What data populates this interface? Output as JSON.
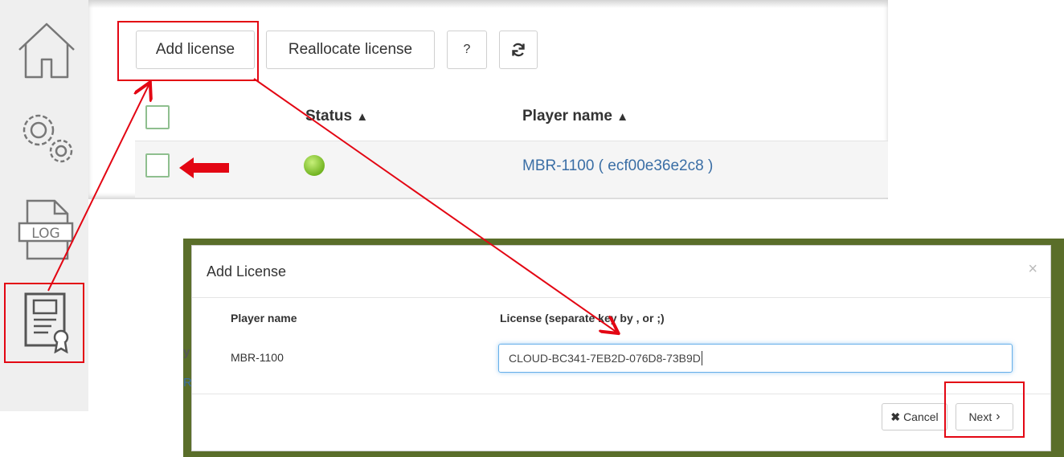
{
  "toolbar": {
    "add_license": "Add license",
    "reallocate_license": "Reallocate license",
    "help": "?",
    "refresh_icon": "refresh-icon"
  },
  "table": {
    "columns": [
      "Status",
      "Player name"
    ],
    "rows": [
      {
        "status": "online",
        "player_name": "MBR-1100 ( ecf00e36e2c8 )"
      }
    ]
  },
  "sidebar": {
    "items": [
      {
        "icon": "home-icon"
      },
      {
        "icon": "settings-gears-icon"
      },
      {
        "icon": "log-file-icon"
      },
      {
        "icon": "license-certificate-icon"
      }
    ]
  },
  "modal": {
    "title": "Add License",
    "close": "×",
    "player_name_label": "Player name",
    "license_label": "License (separate key by , or ;)",
    "player_name_value": "MBR-1100",
    "license_value": "CLOUD-BC341-7EB2D-076D8-73B9D",
    "cancel_label": "Cancel",
    "next_label": "Next"
  },
  "background_fragments": [
    "y",
    "R"
  ],
  "colors": {
    "highlight": "#e30613",
    "status_online": "#8ed12e",
    "link": "#3a6ea5",
    "checkbox_border": "#8fbf8f"
  }
}
